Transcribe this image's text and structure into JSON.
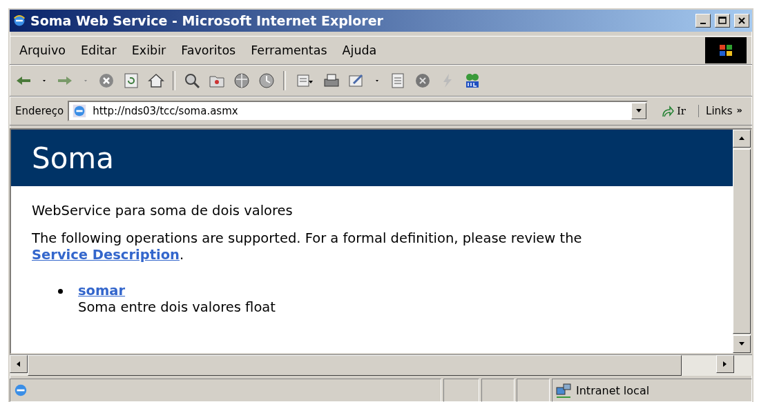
{
  "window": {
    "title": "Soma Web Service - Microsoft Internet Explorer"
  },
  "menu": [
    "Arquivo",
    "Editar",
    "Exibir",
    "Favoritos",
    "Ferramentas",
    "Ajuda"
  ],
  "address_bar": {
    "label": "Endereço",
    "url": "http://nds03/tcc/soma.asmx",
    "go": "Ir",
    "links": "Links",
    "more": "»"
  },
  "page": {
    "heading": "Soma",
    "description": "WebService para soma de dois valores",
    "intro": {
      "text": "The following operations are supported. For a formal definition, please review the ",
      "link": "Service Description",
      "end": "."
    },
    "operations": [
      {
        "name": "somar",
        "description": "Soma entre dois valores float"
      }
    ]
  },
  "status_bar": {
    "zone": "Intranet local"
  }
}
